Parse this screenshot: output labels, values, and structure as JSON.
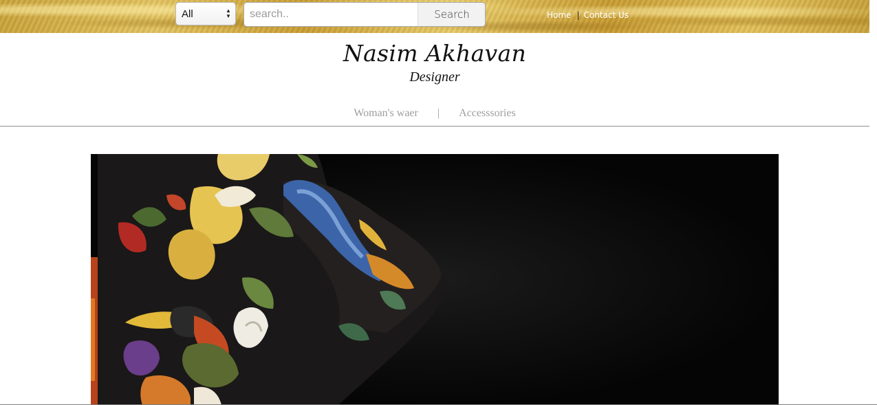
{
  "header": {
    "category_select": {
      "value": "All"
    },
    "search": {
      "placeholder": "search..",
      "button_label": "Search"
    },
    "links": {
      "home": "Home",
      "separator": "|",
      "contact": "Contact Us"
    }
  },
  "brand": {
    "name": "Nasim Akhavan",
    "subtitle": "Designer"
  },
  "nav": {
    "items": [
      {
        "label": "Woman's waer"
      },
      {
        "label": "Accesssories"
      }
    ],
    "separator": "|"
  },
  "hero": {
    "icon": "floral-jacket-photo"
  },
  "colors": {
    "gold": "#d8b44c",
    "nav_text": "#9d9d9d",
    "hero_bg": "#050505"
  }
}
